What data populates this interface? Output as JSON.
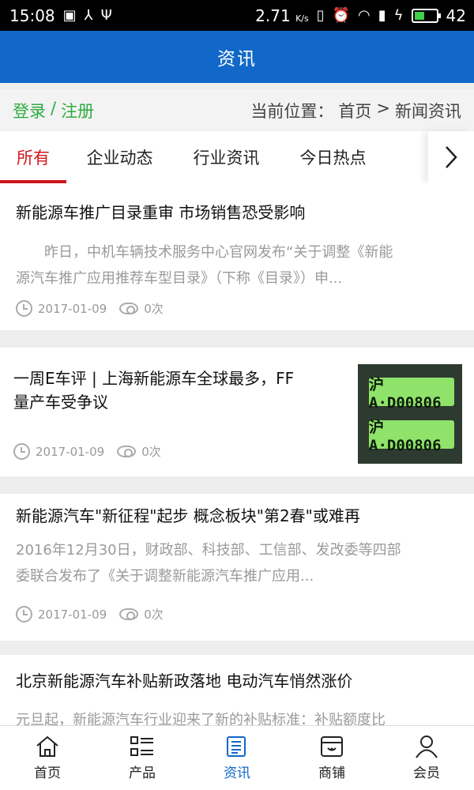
{
  "status_bar": {
    "time": "15:08",
    "speed": "2.71",
    "speed_unit": "K/s",
    "battery": "42"
  },
  "header": {
    "title": "资讯"
  },
  "crumbbar": {
    "login": "登录",
    "separator": "/",
    "register": "注册",
    "location_label": "当前位置：",
    "crumb_home": "首页",
    "crumb_sep": ">",
    "crumb_current": "新闻资讯"
  },
  "tabs": [
    {
      "label": "所有",
      "active": true
    },
    {
      "label": "企业动态"
    },
    {
      "label": "行业资讯"
    },
    {
      "label": "今日热点"
    }
  ],
  "articles": [
    {
      "title": "新能源车推广目录重审 市场销售恐受影响",
      "summary_line1": "　　昨日，中机车辆技术服务中心官网发布“关于调整《新能",
      "summary_line2": "源汽车推广应用推荐车型目录》（下称《目录》）申...",
      "date": "2017-01-09",
      "views": "0次"
    },
    {
      "title_line1": "一周E车评 | 上海新能源车全球最多，FF",
      "title_line2": "量产车受争议",
      "date": "2017-01-09",
      "views": "0次",
      "plate_text_1": "沪A·D00806",
      "plate_text_2": "沪A·D00806"
    },
    {
      "title": "新能源汽车\"新征程\"起步 概念板块\"第2春\"或难再",
      "summary_line1": "2016年12月30日，财政部、科技部、工信部、发改委等四部",
      "summary_line2": "委联合发布了《关于调整新能源汽车推广应用...",
      "date": "2017-01-09",
      "views": "0次"
    },
    {
      "title": "北京新能源汽车补贴新政落地 电动汽车悄然涨价",
      "summary_line1": "元旦起，新能源汽车行业迎来了新的补贴标准：补贴额度比"
    }
  ],
  "bottom_nav": [
    {
      "label": "首页",
      "icon": "home-icon"
    },
    {
      "label": "产品",
      "icon": "list-icon"
    },
    {
      "label": "资讯",
      "icon": "news-icon",
      "active": true
    },
    {
      "label": "商铺",
      "icon": "store-icon"
    },
    {
      "label": "会员",
      "icon": "member-icon"
    }
  ],
  "colors": {
    "header_bg": "#1168c8",
    "accent_red": "#d0161b",
    "login_green": "#2eab3f"
  }
}
